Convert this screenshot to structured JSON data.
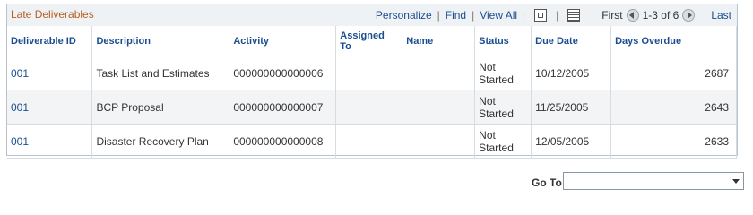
{
  "grid": {
    "title": "Late Deliverables",
    "nav": {
      "personalize": "Personalize",
      "find": "Find",
      "view_all": "View All",
      "first": "First",
      "count": "1-3 of 6",
      "last": "Last"
    },
    "columns": [
      "Deliverable ID",
      "Description",
      "Activity",
      "Assigned To",
      "Name",
      "Status",
      "Due Date",
      "Days Overdue"
    ],
    "rows": [
      {
        "id": "001",
        "description": "Task List and Estimates",
        "activity": "000000000000006",
        "assigned_to": "",
        "name": "",
        "status": "Not Started",
        "due_date": "10/12/2005",
        "days_overdue": "2687"
      },
      {
        "id": "001",
        "description": "BCP Proposal",
        "activity": "000000000000007",
        "assigned_to": "",
        "name": "",
        "status": "Not Started",
        "due_date": "11/25/2005",
        "days_overdue": "2643"
      },
      {
        "id": "001",
        "description": "Disaster Recovery Plan",
        "activity": "000000000000008",
        "assigned_to": "",
        "name": "",
        "status": "Not Started",
        "due_date": "12/05/2005",
        "days_overdue": "2633"
      }
    ]
  },
  "goto": {
    "label": "Go To",
    "selected": ""
  }
}
